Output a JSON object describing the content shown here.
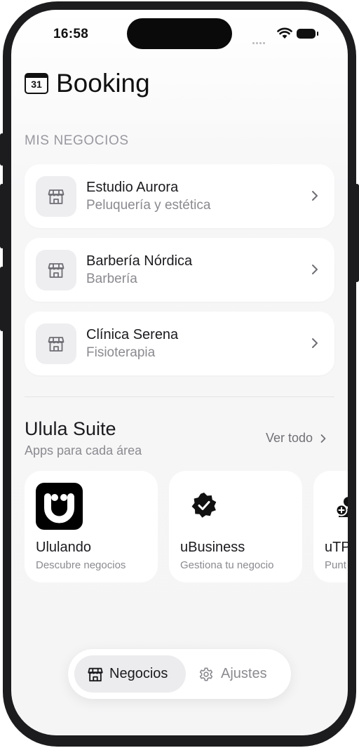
{
  "status_bar": {
    "time": "16:58"
  },
  "header": {
    "calendar_icon_day": "31",
    "title": "Booking"
  },
  "businesses": {
    "section_label": "MIS NEGOCIOS",
    "items": [
      {
        "name": "Estudio Aurora",
        "category": "Peluquería y estética",
        "icon": "store-icon"
      },
      {
        "name": "Barbería Nórdica",
        "category": "Barbería",
        "icon": "store-icon"
      },
      {
        "name": "Clínica Serena",
        "category": "Fisioterapia",
        "icon": "store-icon"
      }
    ]
  },
  "suite": {
    "title": "Ulula Suite",
    "subtitle": "Apps para cada área",
    "see_all": "Ver todo",
    "apps": [
      {
        "name": "Ululando",
        "description": "Descubre negocios",
        "icon": "ululando-logo-icon"
      },
      {
        "name": "uBusiness",
        "description": "Gestiona tu negocio",
        "icon": "verified-badge-icon"
      },
      {
        "name": "uTP",
        "description": "Punt",
        "icon": "add-user-icon"
      }
    ]
  },
  "tab_bar": {
    "tabs": [
      {
        "label": "Negocios",
        "active": true,
        "icon": "store-icon"
      },
      {
        "label": "Ajustes",
        "active": false,
        "icon": "gear-icon"
      }
    ]
  },
  "colors": {
    "background": "#f5f5f6",
    "card": "#ffffff",
    "text_primary": "#1b1b1f",
    "text_secondary": "#8a8a90",
    "icon_tile": "#eeeef0",
    "active_tab": "#ececee"
  }
}
